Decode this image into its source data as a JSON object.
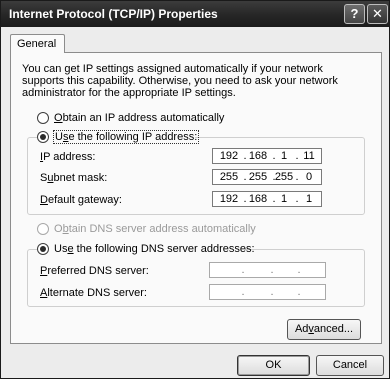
{
  "window": {
    "title": "Internet Protocol (TCP/IP) Properties",
    "help_glyph": "?",
    "close_glyph": "✕"
  },
  "tabs": [
    {
      "label": "General"
    }
  ],
  "intro": "You can get IP settings assigned automatically if your network supports this capability. Otherwise, you need to ask your network administrator for the appropriate IP settings.",
  "ip": {
    "auto": {
      "label_pre": "",
      "mnemonic": "O",
      "label_post": "btain an IP address automatically",
      "checked": false
    },
    "manual": {
      "label_pre": "",
      "mnemonic": "s",
      "label_post": "e the following IP address:",
      "label_prefix": "U",
      "checked": true
    },
    "fields": [
      {
        "label_pre": "",
        "mnemonic": "I",
        "label_post": "P address:",
        "octets": [
          "192",
          "168",
          "1",
          "11"
        ]
      },
      {
        "label_pre": "S",
        "mnemonic": "u",
        "label_post": "bnet mask:",
        "octets": [
          "255",
          "255",
          "255",
          "0"
        ]
      },
      {
        "label_pre": "",
        "mnemonic": "D",
        "label_post": "efault gateway:",
        "octets": [
          "192",
          "168",
          "1",
          "1"
        ]
      }
    ]
  },
  "dns": {
    "auto": {
      "label_pre": "O",
      "mnemonic": "b",
      "label_post": "tain DNS server address automatically",
      "checked": false,
      "enabled": false
    },
    "manual": {
      "label_pre": "Us",
      "mnemonic": "e",
      "label_post": " the following DNS server addresses:",
      "checked": true
    },
    "fields": [
      {
        "label_pre": "",
        "mnemonic": "P",
        "label_post": "referred DNS server:",
        "octets": [
          "",
          "",
          "",
          ""
        ]
      },
      {
        "label_pre": "",
        "mnemonic": "A",
        "label_post": "lternate DNS server:",
        "octets": [
          "",
          "",
          "",
          ""
        ]
      }
    ]
  },
  "buttons": {
    "advanced": {
      "pre": "Ad",
      "mnemonic": "v",
      "post": "anced..."
    },
    "ok": "OK",
    "cancel": "Cancel"
  }
}
